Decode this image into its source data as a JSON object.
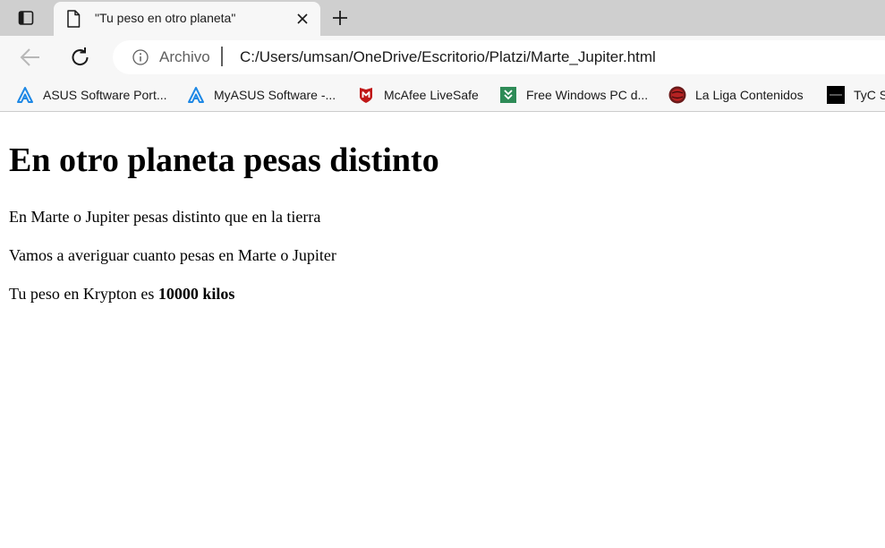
{
  "browser": {
    "tab": {
      "title": "\"Tu peso en otro planeta\""
    },
    "address": {
      "label": "Archivo",
      "url": "C:/Users/umsan/OneDrive/Escritorio/Platzi/Marte_Jupiter.html"
    },
    "bookmarks": [
      {
        "label": "ASUS Software Port...",
        "icon": "asus-icon"
      },
      {
        "label": "MyASUS Software -...",
        "icon": "asus-icon"
      },
      {
        "label": "McAfee LiveSafe",
        "icon": "mcafee-icon"
      },
      {
        "label": "Free Windows PC d...",
        "icon": "download-icon"
      },
      {
        "label": "La Liga Contenidos",
        "icon": "laliga-icon"
      },
      {
        "label": "TyC S",
        "icon": "tyc-icon"
      }
    ]
  },
  "page": {
    "heading": "En otro planeta pesas distinto",
    "paragraph1": "En Marte o Jupiter pesas distinto que en la tierra",
    "paragraph2": "Vamos a averiguar cuanto pesas en Marte o Jupiter",
    "result_prefix": "Tu peso en Krypton es ",
    "result_value": "10000 kilos"
  },
  "colors": {
    "tabstrip": "#cfcfcf",
    "toolbar": "#f7f7f7",
    "asus_blue": "#1e88e5",
    "mcafee_red": "#c01818",
    "download_green": "#2e8b57"
  }
}
